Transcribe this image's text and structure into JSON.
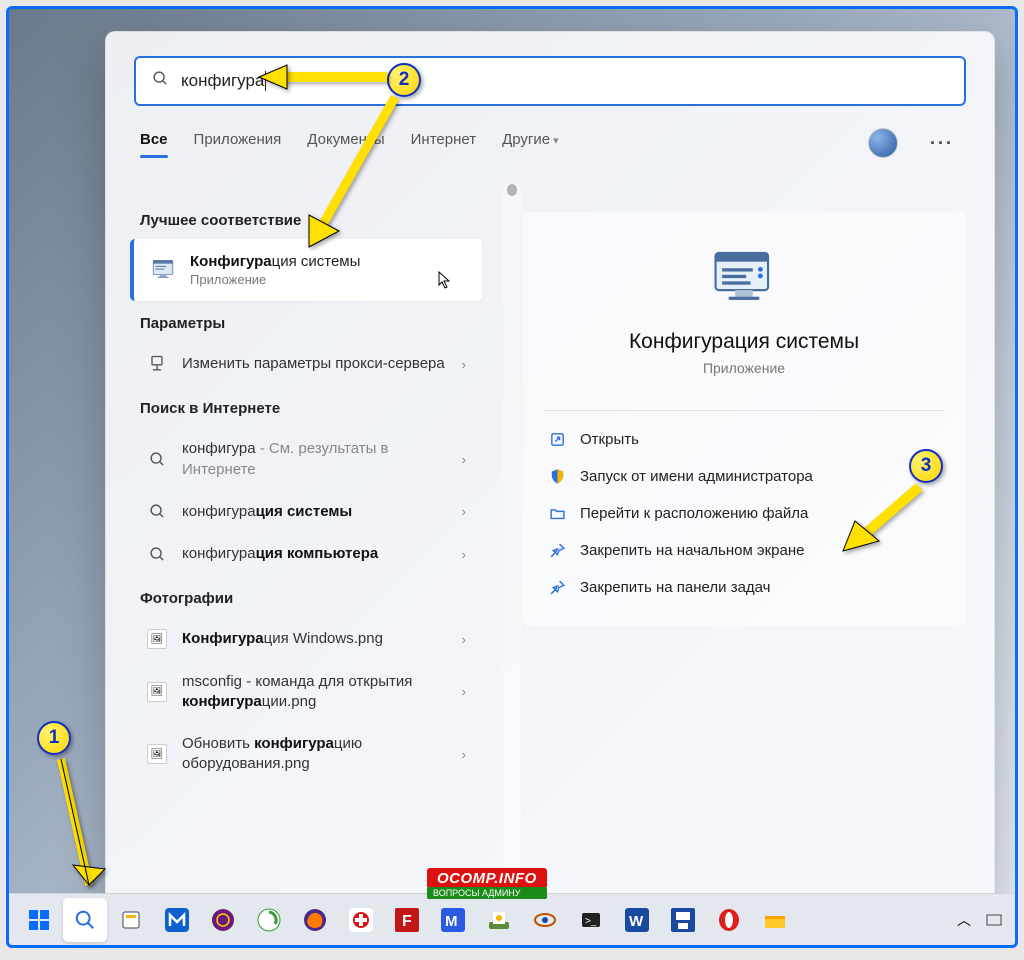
{
  "search": {
    "query": "конфигура"
  },
  "tabs": {
    "all": "Все",
    "apps": "Приложения",
    "docs": "Документы",
    "internet": "Интернет",
    "more": "Другие"
  },
  "sections": {
    "best": "Лучшее соответствие",
    "settings": "Параметры",
    "web": "Поиск в Интернете",
    "photos": "Фотографии"
  },
  "best_match": {
    "title_bold": "Конфигура",
    "title_rest": "ция системы",
    "subtitle": "Приложение"
  },
  "settings_item": {
    "text": "Изменить параметры прокси-сервера"
  },
  "web_items": {
    "a_pre": "конфигура",
    "a_tail": " - См. результаты в Интернете",
    "b_pre": "конфигура",
    "b_bold": "ция системы",
    "c_pre": "конфигура",
    "c_bold": "ция компьютера"
  },
  "photos": {
    "p1_bold": "Конфигура",
    "p1_rest": "ция Windows.png",
    "p2_pre": "msconfig - команда для открытия ",
    "p2_bold": "конфигура",
    "p2_rest": "ции.png",
    "p3_pre": "Обновить ",
    "p3_bold": "конфигура",
    "p3_rest": "цию оборудования.png"
  },
  "detail": {
    "title": "Конфигурация системы",
    "subtitle": "Приложение"
  },
  "actions": {
    "open": "Открыть",
    "admin": "Запуск от имени администратора",
    "loc": "Перейти к расположению файла",
    "pin_start": "Закрепить на начальном экране",
    "pin_task": "Закрепить на панели задач"
  },
  "callouts": {
    "n1": "1",
    "n2": "2",
    "n3": "3"
  },
  "badge": {
    "top": "OCOMP.INFO",
    "bot": "ВОПРОСЫ АДМИНУ"
  }
}
